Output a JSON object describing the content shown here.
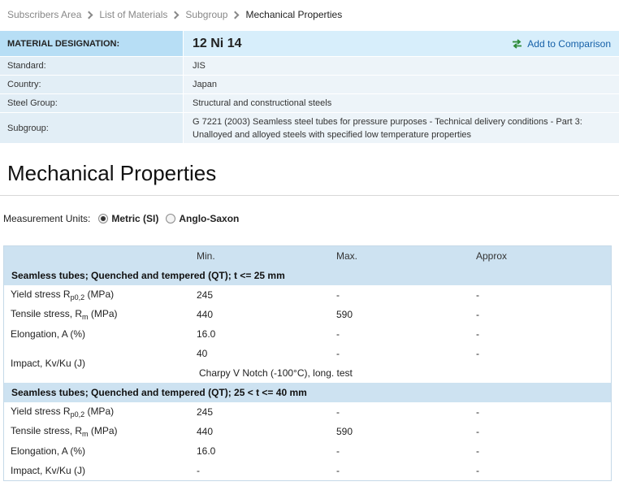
{
  "breadcrumb": [
    "Subscribers Area",
    "List of Materials",
    "Subgroup",
    "Mechanical Properties"
  ],
  "info": {
    "designation_label": "MATERIAL DESIGNATION:",
    "designation_value": "12 Ni 14",
    "compare_label": "Add to Comparison",
    "rows": [
      {
        "label": "Standard:",
        "value": "JIS"
      },
      {
        "label": "Country:",
        "value": "Japan"
      },
      {
        "label": "Steel Group:",
        "value": "Structural and constructional steels"
      },
      {
        "label": "Subgroup:",
        "value": "G 7221 (2003) Seamless steel tubes for pressure purposes - Technical delivery conditions - Part 3: Unalloyed and alloyed steels with specified low temperature properties"
      }
    ]
  },
  "page_title": "Mechanical Properties",
  "units": {
    "label": "Measurement Units:",
    "options": [
      {
        "label": "Metric (SI)",
        "checked": true
      },
      {
        "label": "Anglo-Saxon",
        "checked": false
      }
    ]
  },
  "table": {
    "headers": [
      "",
      "Min.",
      "Max.",
      "Approx"
    ],
    "sections": [
      {
        "title": "Seamless tubes; Quenched and tempered (QT); t <= 25 mm",
        "yield": {
          "label_pre": "Yield stress R",
          "label_sub": "p0,2",
          "label_post": " (MPa)",
          "min": "245",
          "max": "-",
          "approx": "-"
        },
        "tensile": {
          "label_pre": "Tensile stress, R",
          "label_sub": "m",
          "label_post": " (MPa)",
          "min": "440",
          "max": "590",
          "approx": "-"
        },
        "elong": {
          "label": "Elongation, A (%)",
          "min": "16.0",
          "max": "-",
          "approx": "-"
        },
        "impact": {
          "label": "Impact, Kv/Ku (J)",
          "min": "40",
          "max": "-",
          "approx": "-",
          "note": "Charpy V Notch (-100°C), long. test"
        }
      },
      {
        "title": "Seamless tubes; Quenched and tempered (QT); 25 < t <= 40 mm",
        "yield": {
          "label_pre": "Yield stress R",
          "label_sub": "p0,2",
          "label_post": " (MPa)",
          "min": "245",
          "max": "-",
          "approx": "-"
        },
        "tensile": {
          "label_pre": "Tensile stress, R",
          "label_sub": "m",
          "label_post": " (MPa)",
          "min": "440",
          "max": "590",
          "approx": "-"
        },
        "elong": {
          "label": "Elongation, A (%)",
          "min": "16.0",
          "max": "-",
          "approx": "-"
        },
        "impact": {
          "label": "Impact, Kv/Ku (J)",
          "min": "-",
          "max": "-",
          "approx": "-"
        }
      }
    ]
  }
}
